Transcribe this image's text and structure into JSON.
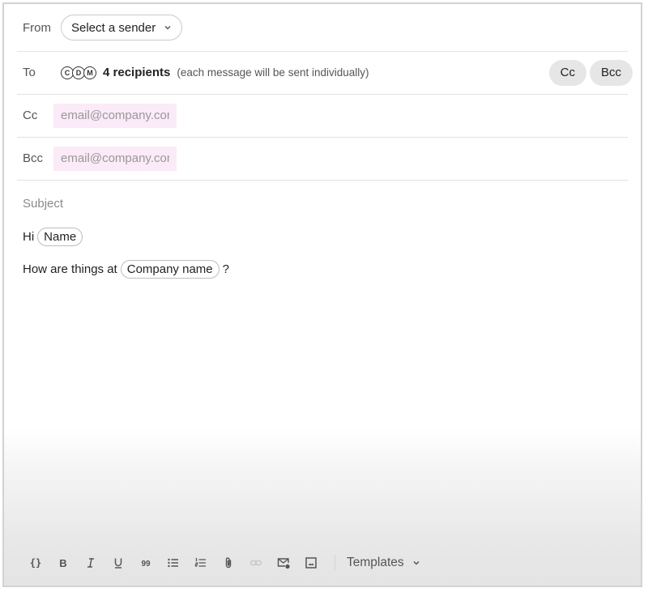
{
  "from": {
    "label": "From",
    "sender_select": "Select a sender"
  },
  "to": {
    "label": "To",
    "avatars": [
      "C",
      "D",
      "M"
    ],
    "recipients_count": "4 recipients",
    "note": "(each message will be sent individually)",
    "cc_button": "Cc",
    "bcc_button": "Bcc"
  },
  "cc": {
    "label": "Cc",
    "placeholder": "email@company.com"
  },
  "bcc": {
    "label": "Bcc",
    "placeholder": "email@company.com"
  },
  "subject": {
    "placeholder": "Subject"
  },
  "body": {
    "line1_prefix": "Hi",
    "line1_token": "Name",
    "line2_prefix": "How are things at",
    "line2_token": "Company name",
    "line2_suffix": "?"
  },
  "toolbar": {
    "icons": [
      "variables-icon",
      "bold-icon",
      "italic-icon",
      "underline-icon",
      "quote-icon",
      "bulleted-list-icon",
      "numbered-list-icon",
      "attachment-icon",
      "link-icon",
      "email-settings-icon",
      "image-icon"
    ],
    "templates_label": "Templates"
  },
  "colors": {
    "input_highlight": "#fbeaf8",
    "pill_bg": "#e6e6e6",
    "border": "#e2e2e2"
  }
}
